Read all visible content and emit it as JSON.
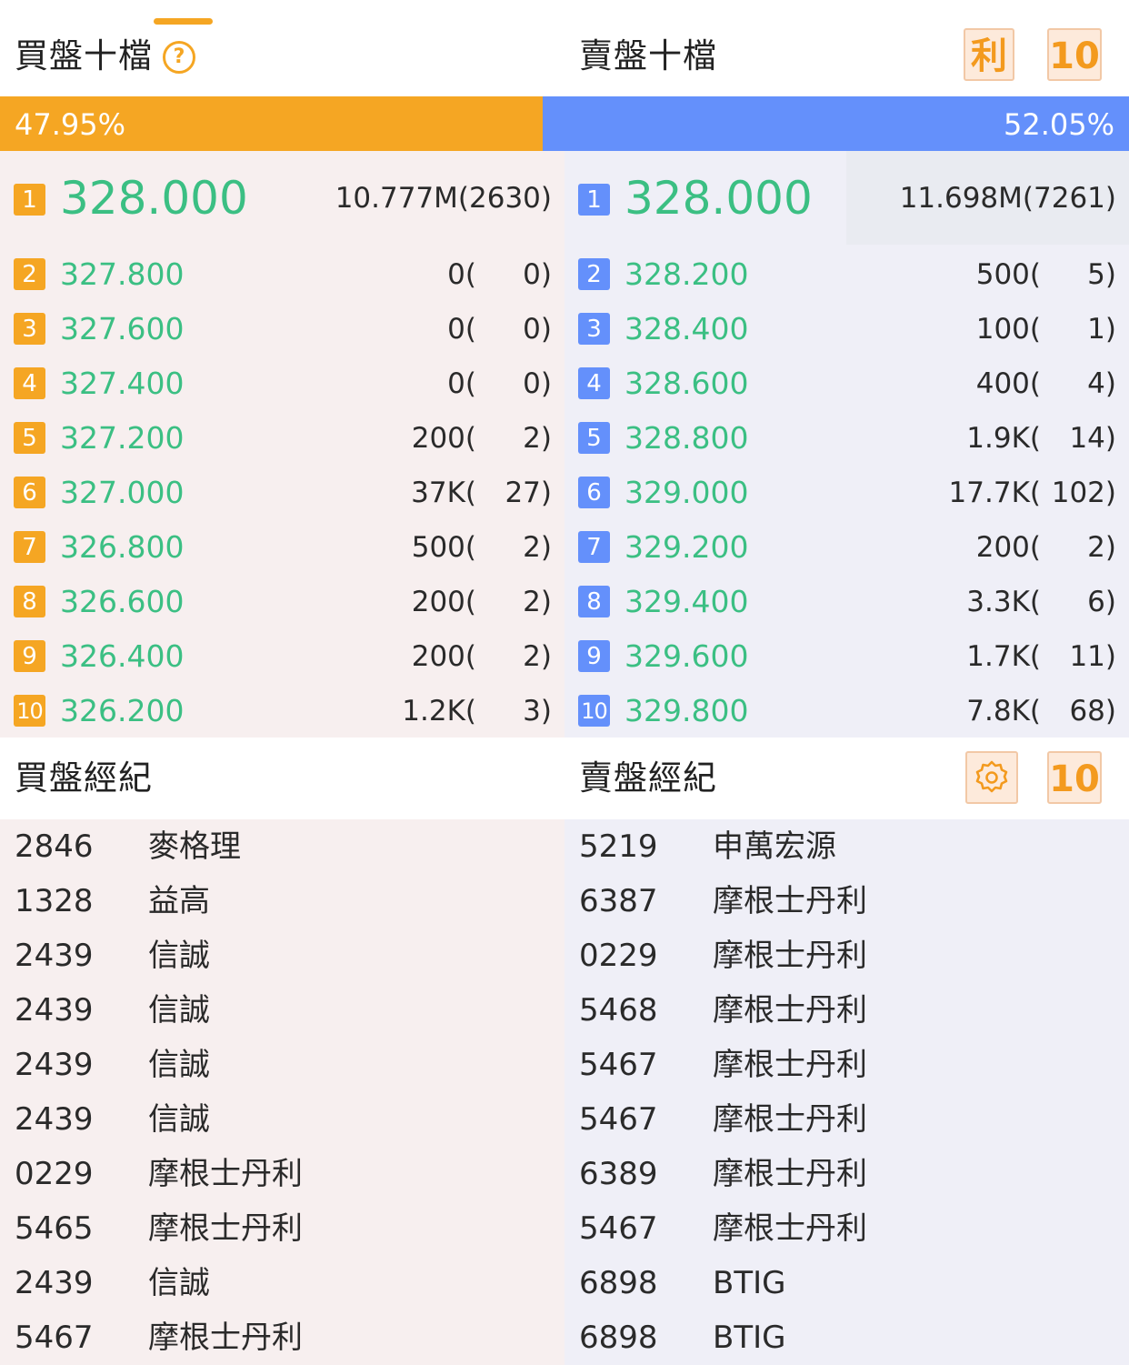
{
  "header": {
    "bid_title": "買盤十檔",
    "ask_title": "賣盤十檔",
    "help_symbol": "?",
    "profit_button": "利",
    "depth_button": "10",
    "accent_color": "#f5a623"
  },
  "ratio": {
    "bid_percent": "47.95%",
    "ask_percent": "52.05%",
    "bid_fraction": 0.4795,
    "bid_color": "#f5a623",
    "ask_color": "#6490fb"
  },
  "bids": [
    {
      "level": "1",
      "price": "328.000",
      "volume": "10.777M",
      "orders": "(2630)",
      "detail": "10.777M(2630)"
    },
    {
      "level": "2",
      "price": "327.800",
      "volume": "0(",
      "orders": "0)"
    },
    {
      "level": "3",
      "price": "327.600",
      "volume": "0(",
      "orders": "0)"
    },
    {
      "level": "4",
      "price": "327.400",
      "volume": "0(",
      "orders": "0)"
    },
    {
      "level": "5",
      "price": "327.200",
      "volume": "200(",
      "orders": "2)"
    },
    {
      "level": "6",
      "price": "327.000",
      "volume": "37K(",
      "orders": "27)"
    },
    {
      "level": "7",
      "price": "326.800",
      "volume": "500(",
      "orders": "2)"
    },
    {
      "level": "8",
      "price": "326.600",
      "volume": "200(",
      "orders": "2)"
    },
    {
      "level": "9",
      "price": "326.400",
      "volume": "200(",
      "orders": "2)"
    },
    {
      "level": "10",
      "price": "326.200",
      "volume": "1.2K(",
      "orders": "3)"
    }
  ],
  "asks": [
    {
      "level": "1",
      "price": "328.000",
      "detail": "11.698M(7261)"
    },
    {
      "level": "2",
      "price": "328.200",
      "volume": "500(",
      "orders": "5)"
    },
    {
      "level": "3",
      "price": "328.400",
      "volume": "100(",
      "orders": "1)"
    },
    {
      "level": "4",
      "price": "328.600",
      "volume": "400(",
      "orders": "4)"
    },
    {
      "level": "5",
      "price": "328.800",
      "volume": "1.9K(",
      "orders": "14)"
    },
    {
      "level": "6",
      "price": "329.000",
      "volume": "17.7K(",
      "orders": "102)"
    },
    {
      "level": "7",
      "price": "329.200",
      "volume": "200(",
      "orders": "2)"
    },
    {
      "level": "8",
      "price": "329.400",
      "volume": "3.3K(",
      "orders": "6)"
    },
    {
      "level": "9",
      "price": "329.600",
      "volume": "1.7K(",
      "orders": "11)"
    },
    {
      "level": "10",
      "price": "329.800",
      "volume": "7.8K(",
      "orders": "68)"
    }
  ],
  "brokers_header": {
    "bid_title": "買盤經紀",
    "ask_title": "賣盤經紀",
    "settings_icon": "gear-icon",
    "depth_button": "10"
  },
  "bid_brokers": [
    {
      "code": "2846",
      "name": "麥格理"
    },
    {
      "code": "1328",
      "name": "益高"
    },
    {
      "code": "2439",
      "name": "信誠"
    },
    {
      "code": "2439",
      "name": "信誠"
    },
    {
      "code": "2439",
      "name": "信誠"
    },
    {
      "code": "2439",
      "name": "信誠"
    },
    {
      "code": "0229",
      "name": "摩根士丹利"
    },
    {
      "code": "5465",
      "name": "摩根士丹利"
    },
    {
      "code": "2439",
      "name": "信誠"
    },
    {
      "code": "5467",
      "name": "摩根士丹利"
    }
  ],
  "ask_brokers": [
    {
      "code": "5219",
      "name": "申萬宏源"
    },
    {
      "code": "6387",
      "name": "摩根士丹利"
    },
    {
      "code": "0229",
      "name": "摩根士丹利"
    },
    {
      "code": "5468",
      "name": "摩根士丹利"
    },
    {
      "code": "5467",
      "name": "摩根士丹利"
    },
    {
      "code": "5467",
      "name": "摩根士丹利"
    },
    {
      "code": "6389",
      "name": "摩根士丹利"
    },
    {
      "code": "5467",
      "name": "摩根士丹利"
    },
    {
      "code": "6898",
      "name": "BTIG"
    },
    {
      "code": "6898",
      "name": "BTIG"
    }
  ]
}
